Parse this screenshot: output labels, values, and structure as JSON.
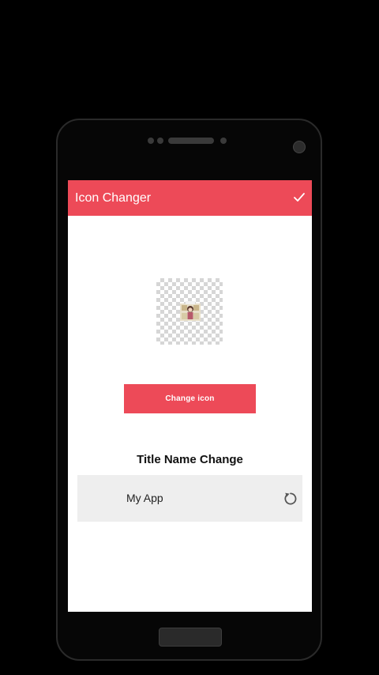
{
  "appbar": {
    "title": "Icon Changer",
    "confirm_icon": "check-icon",
    "color": "#ed4a58"
  },
  "icon_preview": {
    "icon": "app-icon-image"
  },
  "change_icon_button": {
    "label": "Change icon"
  },
  "title_section": {
    "heading": "Title Name Change",
    "app_name_value": "My App",
    "reset_icon": "reset-icon"
  }
}
